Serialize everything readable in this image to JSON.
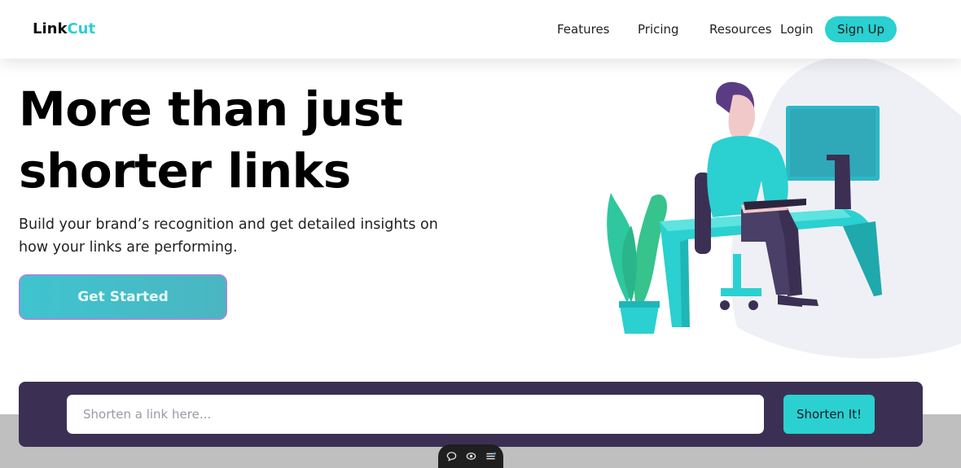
{
  "nav": {
    "logo_left": "Link",
    "logo_right": "Cut",
    "links": [
      "Features",
      "Pricing",
      "Resources"
    ],
    "login": "Login",
    "signup": "Sign Up"
  },
  "hero": {
    "title_line1": "More than just",
    "title_line2": "shorter links",
    "description": "Build your brand’s recognition and get detailed insights on how your links are performing.",
    "cta": "Get Started"
  },
  "shorten": {
    "placeholder": "Shorten a link here...",
    "button": "Shorten It!"
  },
  "dock": {
    "icons": [
      "chat-icon",
      "eye-icon",
      "menu-icon"
    ]
  },
  "colors": {
    "accent": "#2bd0d0",
    "dark_violet": "#3b3054"
  }
}
